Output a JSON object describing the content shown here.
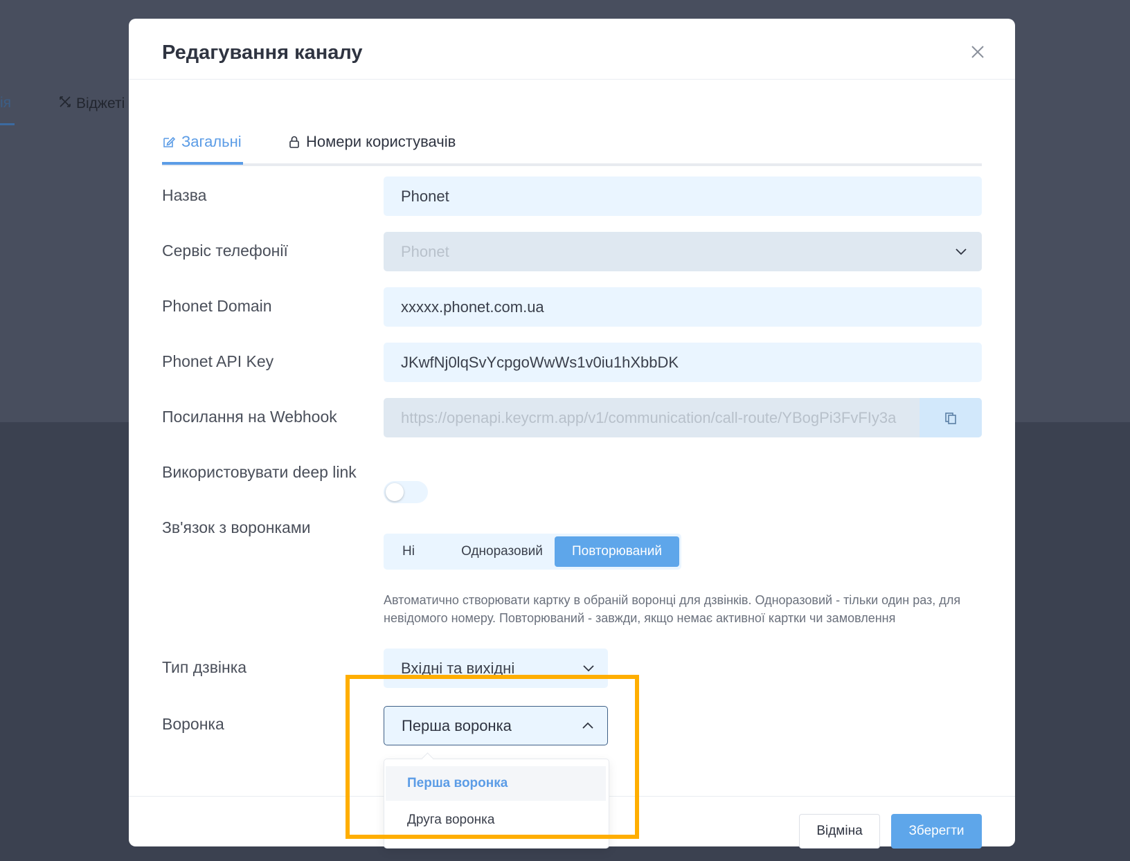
{
  "background": {
    "tab_partial": "ія",
    "tab_widgets": "Віджеті"
  },
  "modal": {
    "title": "Редагування каналу",
    "tabs": [
      {
        "label": "Загальні",
        "icon": "edit-icon",
        "active": true
      },
      {
        "label": "Номери користувачів",
        "icon": "lock-icon",
        "active": false
      }
    ]
  },
  "form": {
    "name": {
      "label": "Назва",
      "value": "Phonet"
    },
    "telephony": {
      "label": "Сервіс телефонії",
      "value": "Phonet",
      "disabled": true
    },
    "domain": {
      "label": "Phonet Domain",
      "value": "xxxxx.phonet.com.ua"
    },
    "api_key": {
      "label": "Phonet API Key",
      "value": "JKwfNj0lqSvYcpgoWwWs1v0iu1hXbbDK"
    },
    "webhook": {
      "label": "Посилання на Webhook",
      "value": "https://openapi.keycrm.app/v1/communication/call-route/YBogPi3FvFIy3a"
    },
    "deep_link": {
      "label": "Використовувати deep link",
      "enabled": false
    },
    "funnel_link": {
      "label": "Зв'язок з воронками",
      "options": [
        "Ні",
        "Одноразовий",
        "Повторюваний"
      ],
      "selected": "Повторюваний",
      "hint": "Автоматично створювати картку в обраній воронці для дзвінків. Одноразовий - тільки один раз, для невідомого номеру. Повторюваний - завжди, якщо немає активної картки чи замовлення"
    },
    "call_type": {
      "label": "Тип дзвінка",
      "value": "Вхідні та вихідні"
    },
    "funnel": {
      "label": "Воронка",
      "value": "Перша воронка",
      "options": [
        "Перша воронка",
        "Друга воронка"
      ]
    }
  },
  "footer": {
    "cancel_label": "Відміна",
    "save_label": "Зберегти"
  },
  "colors": {
    "accent": "#5ea6ea",
    "highlight": "#ffae00",
    "field_bg": "#eaf5ff"
  }
}
